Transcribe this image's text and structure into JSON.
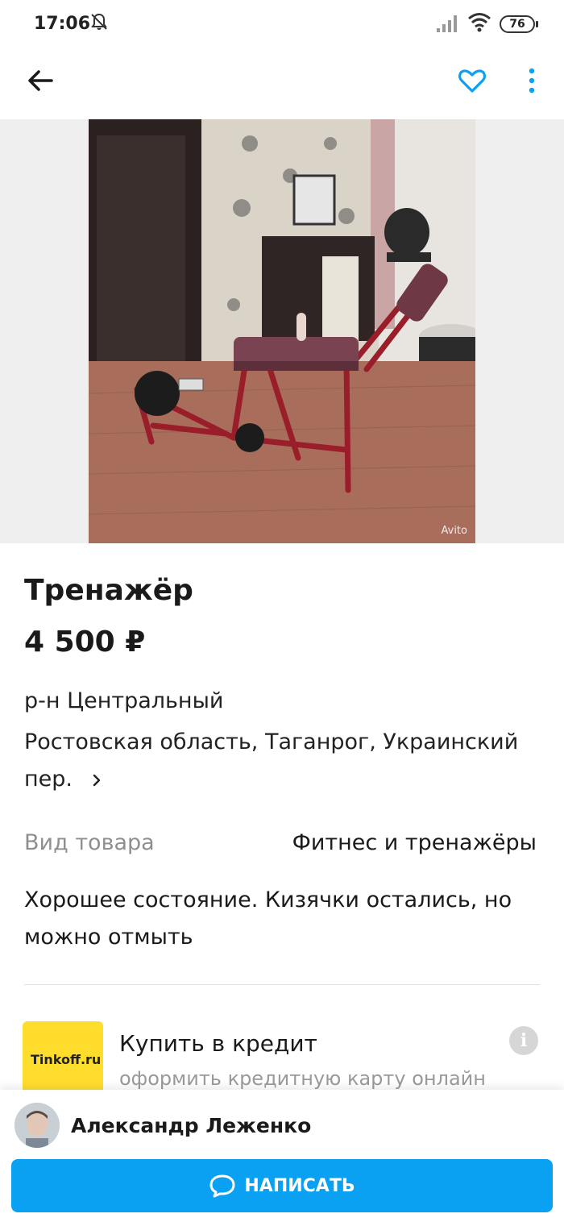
{
  "status_bar": {
    "time": "17:06",
    "battery": "76"
  },
  "app_bar": {
    "back_icon": "arrow-left-icon",
    "favorite_icon": "heart-icon",
    "more_icon": "more-vertical-icon",
    "accent_color": "#0aa1f2"
  },
  "gallery": {
    "watermark": "Avito"
  },
  "listing": {
    "title": "Тренажёр",
    "price": "4 500 ₽",
    "district": "р-н Центральный",
    "address": "Ростовская область, Таганрог, Украинский пер.",
    "param_label": "Вид товара",
    "param_value": "Фитнес и тренажёры",
    "description": "Хорошее состояние. Кизячки остались, но можно отмыть"
  },
  "credit": {
    "logo_text": "Tinkoff.ru",
    "title": "Купить в кредит",
    "subtitle": "оформить кредитную карту онлайн",
    "logo_color": "#ffdd2d"
  },
  "seller": {
    "name": "Александр Леженко"
  },
  "actions": {
    "write_label": "НАПИСАТЬ",
    "button_color": "#0aa1f2"
  }
}
